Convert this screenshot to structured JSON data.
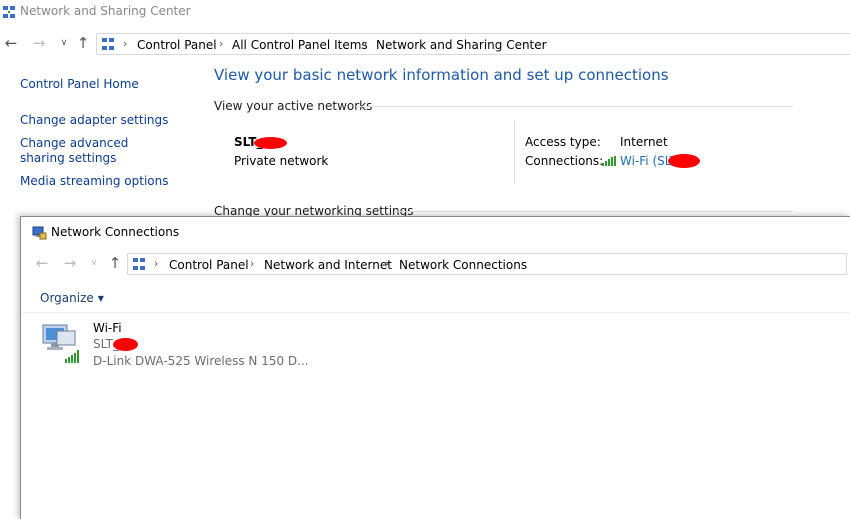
{
  "nsc": {
    "title": "Network and Sharing Center",
    "breadcrumb": [
      "Control Panel",
      "All Control Panel Items",
      "Network and Sharing Center"
    ],
    "sidebar": {
      "home": "Control Panel Home",
      "links": [
        "Change adapter settings",
        "Change advanced sharing settings",
        "Media streaming options"
      ]
    },
    "heading": "View your basic network information and set up connections",
    "active_networks_label": "View your active networks",
    "network": {
      "name": "SLT_",
      "type": "Private network",
      "access_type_label": "Access type:",
      "access_type_value": "Internet",
      "connections_label": "Connections:",
      "connections_value": "Wi-Fi (SLT"
    },
    "change_settings_label": "Change your networking settings"
  },
  "nc": {
    "title": "Network Connections",
    "breadcrumb": [
      "Control Panel",
      "Network and Internet",
      "Network Connections"
    ],
    "organize_label": "Organize",
    "adapter": {
      "name": "Wi-Fi",
      "ssid": "SLT_",
      "device": "D-Link DWA-525 Wireless N 150 D..."
    }
  },
  "colors": {
    "link": "#0a3d91",
    "heading": "#1e5aa8",
    "signal": "#2e9b2e",
    "redaction": "#ff0000"
  },
  "icons": [
    "network-center-icon",
    "back-arrow-icon",
    "forward-arrow-icon",
    "recent-chevron-icon",
    "up-arrow-icon",
    "control-panel-icon",
    "wifi-signal-icon",
    "wifi-adapter-icon"
  ]
}
